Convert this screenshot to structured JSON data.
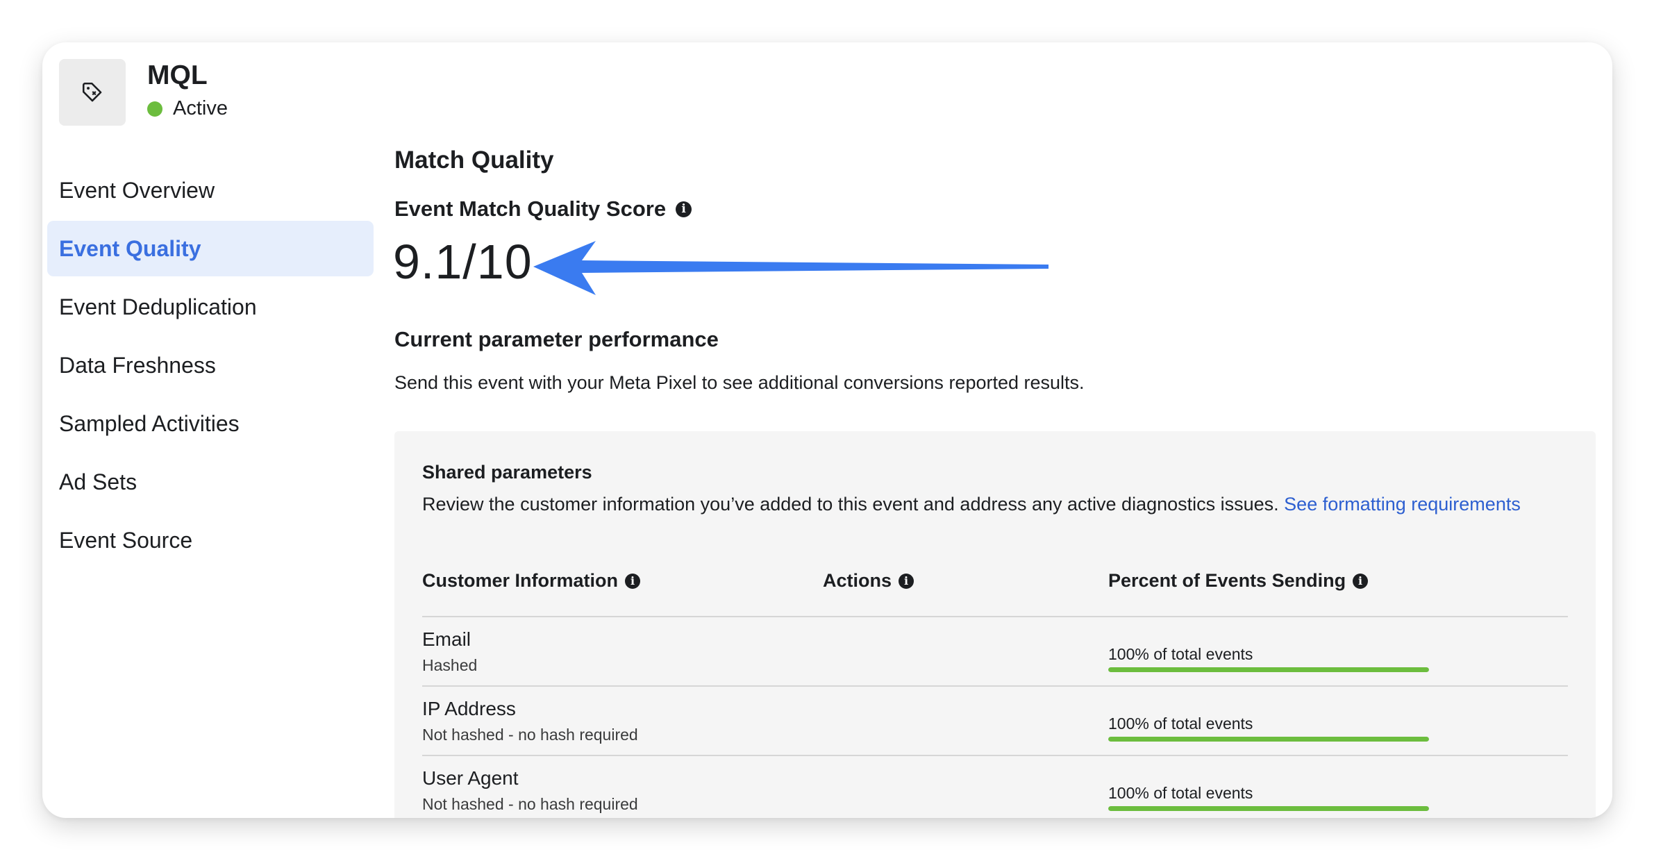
{
  "event": {
    "name": "MQL",
    "status": "Active",
    "icon": "tag-icon",
    "status_color": "#6cbd3e"
  },
  "sidebar": {
    "items": [
      {
        "label": "Event Overview",
        "active": false
      },
      {
        "label": "Event Quality",
        "active": true
      },
      {
        "label": "Event Deduplication",
        "active": false
      },
      {
        "label": "Data Freshness",
        "active": false
      },
      {
        "label": "Sampled Activities",
        "active": false
      },
      {
        "label": "Ad Sets",
        "active": false
      },
      {
        "label": "Event Source",
        "active": false
      }
    ]
  },
  "main": {
    "section_title": "Match Quality",
    "score_label": "Event Match Quality Score",
    "score_value": "9.1/10",
    "perf_title": "Current parameter performance",
    "perf_desc": "Send this event with your Meta Pixel to see additional conversions reported results."
  },
  "shared": {
    "title": "Shared parameters",
    "desc": "Review the customer information you’ve added to this event and address any active diagnostics issues. ",
    "link": "See formatting requirements",
    "columns": [
      "Customer Information",
      "Actions",
      "Percent of Events Sending"
    ],
    "rows": [
      {
        "name": "Email",
        "sub": "Hashed",
        "pct_text": "100% of total events",
        "pct": 100
      },
      {
        "name": "IP Address",
        "sub": "Not hashed - no hash required",
        "pct_text": "100% of total events",
        "pct": 100
      },
      {
        "name": "User Agent",
        "sub": "Not hashed - no hash required",
        "pct_text": "100% of total events",
        "pct": 100
      }
    ]
  },
  "colors": {
    "accent": "#3a6fe0",
    "link": "#2d5fd0",
    "success": "#6cbd3e",
    "arrow": "#3a7bf0"
  }
}
